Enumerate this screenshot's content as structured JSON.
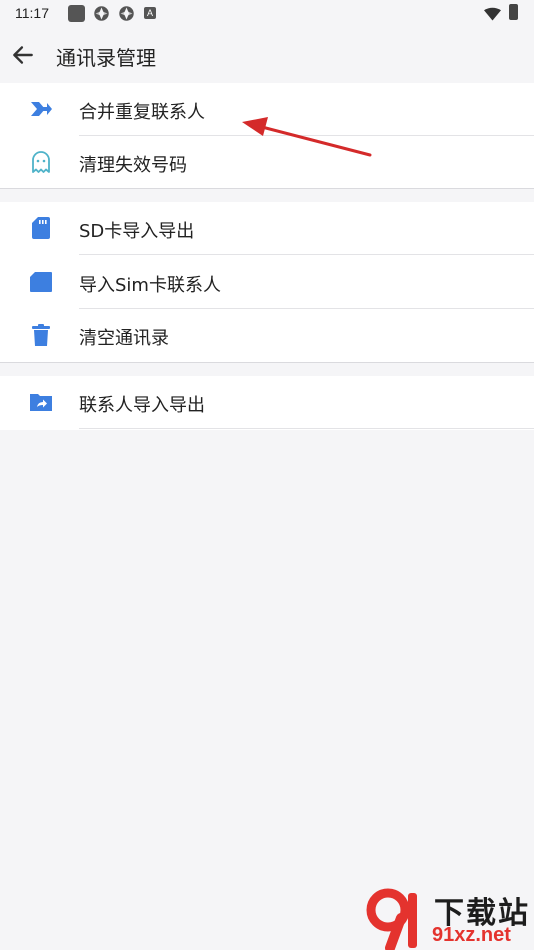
{
  "status_bar": {
    "time": "11:17",
    "indicator_letter": "A"
  },
  "header": {
    "title": "通讯录管理"
  },
  "colors": {
    "accent": "#3d7fe0",
    "ghost": "#4fb3c9",
    "arrow_annotation": "#d42a2a"
  },
  "groups": [
    {
      "items": [
        {
          "label": "合并重复联系人",
          "icon": "merge-arrow-icon"
        },
        {
          "label": "清理失效号码",
          "icon": "ghost-icon"
        }
      ]
    },
    {
      "items": [
        {
          "label": "SD卡导入导出",
          "icon": "sd-card-icon"
        },
        {
          "label": "导入Sim卡联系人",
          "icon": "sim-card-icon"
        },
        {
          "label": "清空通讯录",
          "icon": "trash-icon"
        }
      ]
    },
    {
      "items": [
        {
          "label": "联系人导入导出",
          "icon": "folder-share-icon"
        }
      ]
    }
  ],
  "watermark": {
    "top_text": "下载站",
    "bottom_text": "91xz.net"
  }
}
